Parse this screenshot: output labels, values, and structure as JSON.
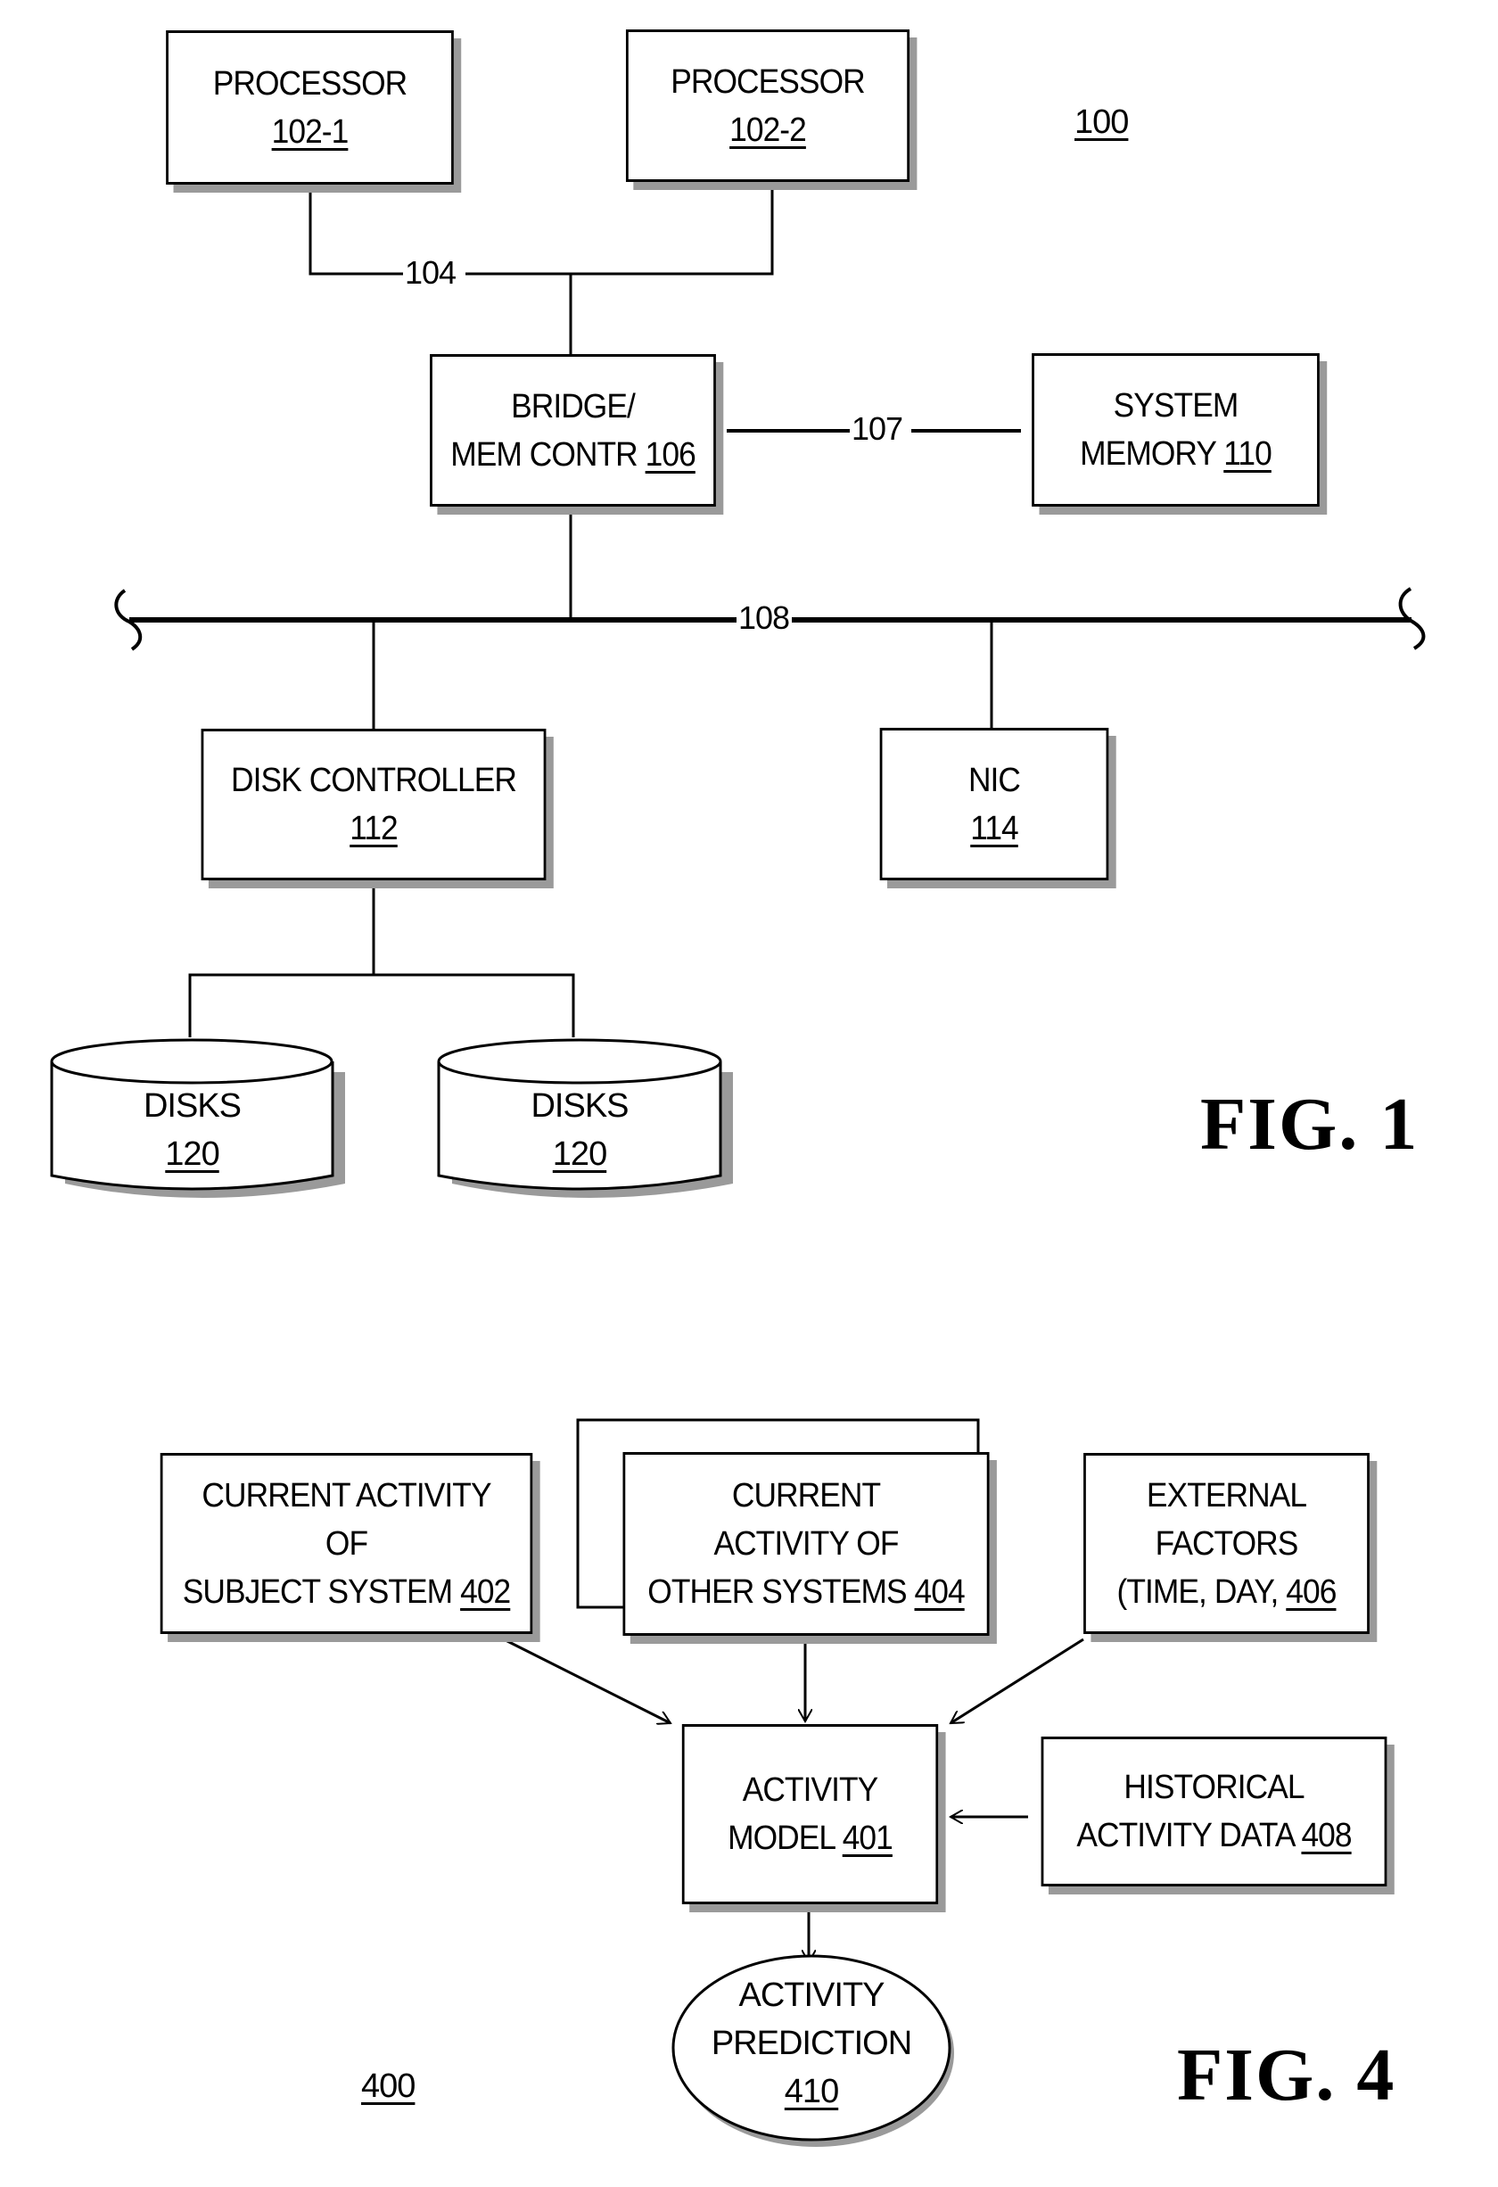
{
  "fig1": {
    "figure_label": "FIG. 1",
    "system_ref": "100",
    "processor_1": {
      "title": "PROCESSOR",
      "ref": "102-1"
    },
    "processor_2": {
      "title": "PROCESSOR",
      "ref": "102-2"
    },
    "bus_104_label": "104",
    "bridge": {
      "line1": "BRIDGE/",
      "line2": "MEM CONTR",
      "ref": "106"
    },
    "link_107_label": "107",
    "system_memory": {
      "line1": "SYSTEM",
      "line2": "MEMORY",
      "ref": "110"
    },
    "bus_108_label": "108",
    "disk_controller": {
      "title": "DISK CONTROLLER",
      "ref": "112"
    },
    "nic": {
      "title": "NIC",
      "ref": "114"
    },
    "disks": [
      {
        "title": "DISKS",
        "ref": "120"
      },
      {
        "title": "DISKS",
        "ref": "120"
      }
    ]
  },
  "fig4": {
    "figure_label": "FIG. 4",
    "system_ref": "400",
    "subject_activity": {
      "line1": "CURRENT ACTIVITY",
      "line2": "OF",
      "line3": "SUBJECT SYSTEM",
      "ref": "402"
    },
    "other_activity": {
      "line1": "CURRENT",
      "line2": "ACTIVITY OF",
      "line3": "OTHER SYSTEMS",
      "ref": "404"
    },
    "external_factors": {
      "line1": "EXTERNAL",
      "line2": "FACTORS",
      "line3": "(TIME, DAY,",
      "ref": "406"
    },
    "activity_model": {
      "line1": "ACTIVITY",
      "line2": "MODEL",
      "ref": "401"
    },
    "historical_data": {
      "line1": "HISTORICAL",
      "line2": "ACTIVITY DATA",
      "ref": "408"
    },
    "prediction": {
      "line1": "ACTIVITY",
      "line2": "PREDICTION",
      "ref": "410"
    }
  }
}
